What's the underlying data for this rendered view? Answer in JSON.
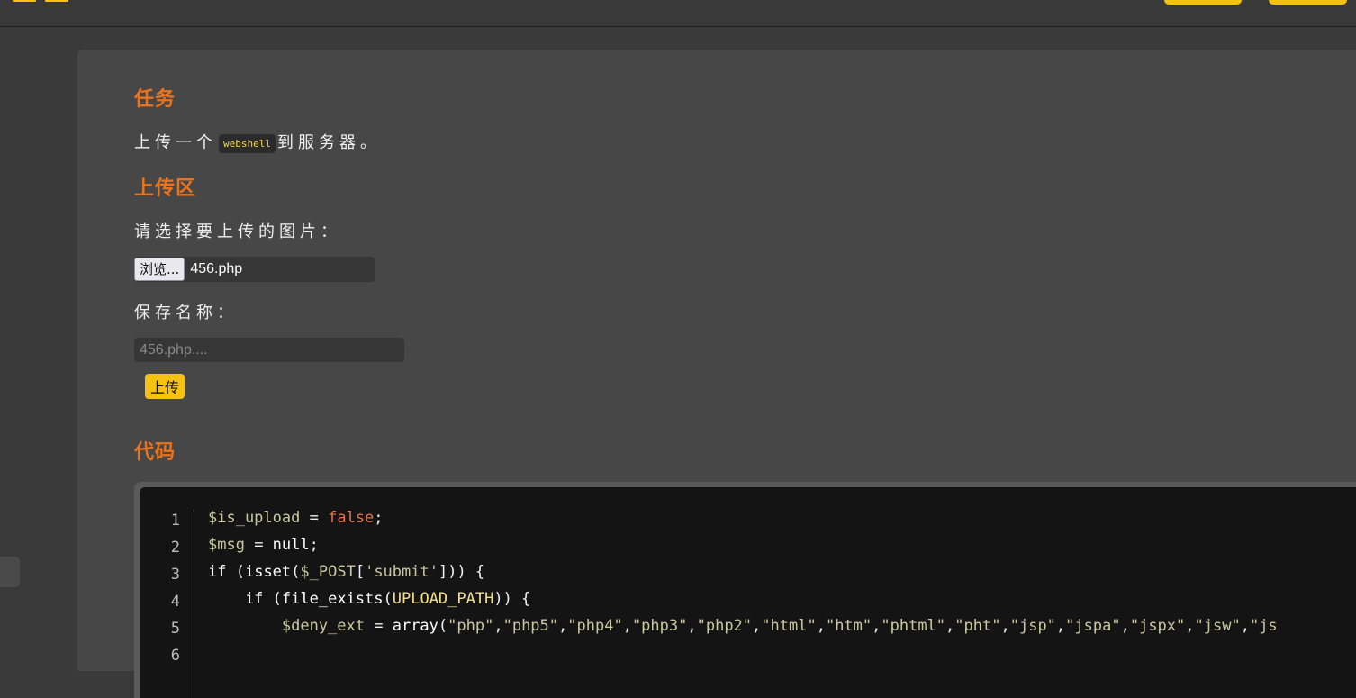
{
  "sections": {
    "task_heading": "任务",
    "task_text_before": "上传一个",
    "task_code": "webshell",
    "task_text_after": "到服务器。",
    "upload_heading": "上传区",
    "select_label": "请选择要上传的图片：",
    "browse_button": "浏览...",
    "selected_file": "456.php",
    "save_label": "保存名称：",
    "save_placeholder": "456.php....",
    "upload_button": "上传",
    "code_heading": "代码"
  },
  "code": {
    "line_numbers": [
      "1",
      "2",
      "3",
      "4",
      "5",
      "6"
    ],
    "lines": [
      [
        {
          "t": "$is_upload",
          "c": "var"
        },
        {
          "t": " = ",
          "c": ""
        },
        {
          "t": "false",
          "c": "bool"
        },
        {
          "t": ";",
          "c": ""
        }
      ],
      [
        {
          "t": "$msg",
          "c": "var"
        },
        {
          "t": " = ",
          "c": ""
        },
        {
          "t": "null",
          "c": "kw"
        },
        {
          "t": ";",
          "c": ""
        }
      ],
      [
        {
          "t": "if",
          "c": "kw"
        },
        {
          "t": " (",
          "c": ""
        },
        {
          "t": "isset",
          "c": "kw"
        },
        {
          "t": "(",
          "c": ""
        },
        {
          "t": "$_POST",
          "c": "var"
        },
        {
          "t": "[",
          "c": ""
        },
        {
          "t": "'submit'",
          "c": "str"
        },
        {
          "t": "])) {",
          "c": ""
        }
      ],
      [
        {
          "t": "    if",
          "c": "kw"
        },
        {
          "t": " (",
          "c": ""
        },
        {
          "t": "file_exists",
          "c": "kw"
        },
        {
          "t": "(",
          "c": ""
        },
        {
          "t": "UPLOAD_PATH",
          "c": "const"
        },
        {
          "t": ")) {",
          "c": ""
        }
      ],
      [
        {
          "t": "        $deny_ext",
          "c": "var"
        },
        {
          "t": " = ",
          "c": ""
        },
        {
          "t": "array",
          "c": "kw"
        },
        {
          "t": "(",
          "c": ""
        },
        {
          "t": "\"php\"",
          "c": "str"
        },
        {
          "t": ",",
          "c": ""
        },
        {
          "t": "\"php5\"",
          "c": "str"
        },
        {
          "t": ",",
          "c": ""
        },
        {
          "t": "\"php4\"",
          "c": "str"
        },
        {
          "t": ",",
          "c": ""
        },
        {
          "t": "\"php3\"",
          "c": "str"
        },
        {
          "t": ",",
          "c": ""
        },
        {
          "t": "\"php2\"",
          "c": "str"
        },
        {
          "t": ",",
          "c": ""
        },
        {
          "t": "\"html\"",
          "c": "str"
        },
        {
          "t": ",",
          "c": ""
        },
        {
          "t": "\"htm\"",
          "c": "str"
        },
        {
          "t": ",",
          "c": ""
        },
        {
          "t": "\"phtml\"",
          "c": "str"
        },
        {
          "t": ",",
          "c": ""
        },
        {
          "t": "\"pht\"",
          "c": "str"
        },
        {
          "t": ",",
          "c": ""
        },
        {
          "t": "\"jsp\"",
          "c": "str"
        },
        {
          "t": ",",
          "c": ""
        },
        {
          "t": "\"jspa\"",
          "c": "str"
        },
        {
          "t": ",",
          "c": ""
        },
        {
          "t": "\"jspx\"",
          "c": "str"
        },
        {
          "t": ",",
          "c": ""
        },
        {
          "t": "\"jsw\"",
          "c": "str"
        },
        {
          "t": ",",
          "c": ""
        },
        {
          "t": "\"js",
          "c": "str"
        }
      ],
      []
    ]
  }
}
